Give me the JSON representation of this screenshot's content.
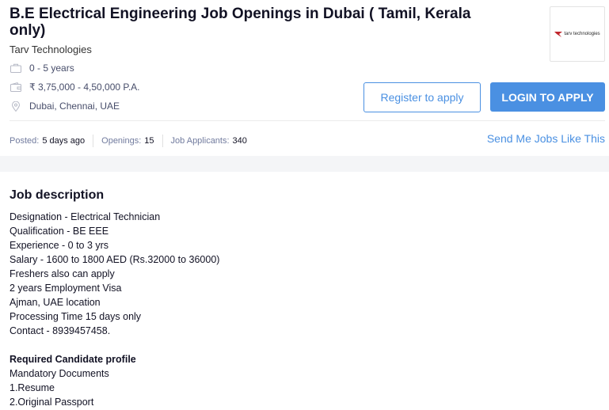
{
  "job": {
    "title": "B.E Electrical Engineering Job Openings in Dubai ( Tamil, Kerala only)",
    "company": "Tarv Technologies",
    "experience": "0 - 5 years",
    "salary": "₹ 3,75,000 - 4,50,000 P.A.",
    "location": "Dubai, Chennai, UAE",
    "logo_text": "tarv technologies"
  },
  "actions": {
    "register_label": "Register to apply",
    "login_label": "LOGIN TO APPLY",
    "similar_jobs_label": "Send Me Jobs Like This"
  },
  "stats": {
    "posted_label": "Posted:",
    "posted_value": "5 days ago",
    "openings_label": "Openings:",
    "openings_value": "15",
    "applicants_label": "Job Applicants:",
    "applicants_value": "340"
  },
  "description": {
    "heading": "Job description",
    "lines": [
      "Designation - Electrical Technician",
      "Qualification - BE EEE",
      "Experience - 0 to 3 yrs",
      "Salary - 1600 to 1800 AED (Rs.32000 to 36000)",
      "Freshers also can apply",
      "2 years Employment Visa",
      "Ajman, UAE location",
      "Processing Time 15 days only",
      "Contact - 8939457458."
    ],
    "profile_heading": "Required Candidate profile",
    "profile_lines": [
      "Mandatory Documents",
      "1.Resume",
      "2.Original Passport"
    ]
  },
  "colors": {
    "accent": "#4a90e2",
    "text": "#121224",
    "muted": "#717b9e",
    "logo_red": "#c0272d"
  },
  "icons": [
    "briefcase-icon",
    "wallet-icon",
    "location-pin-icon"
  ]
}
